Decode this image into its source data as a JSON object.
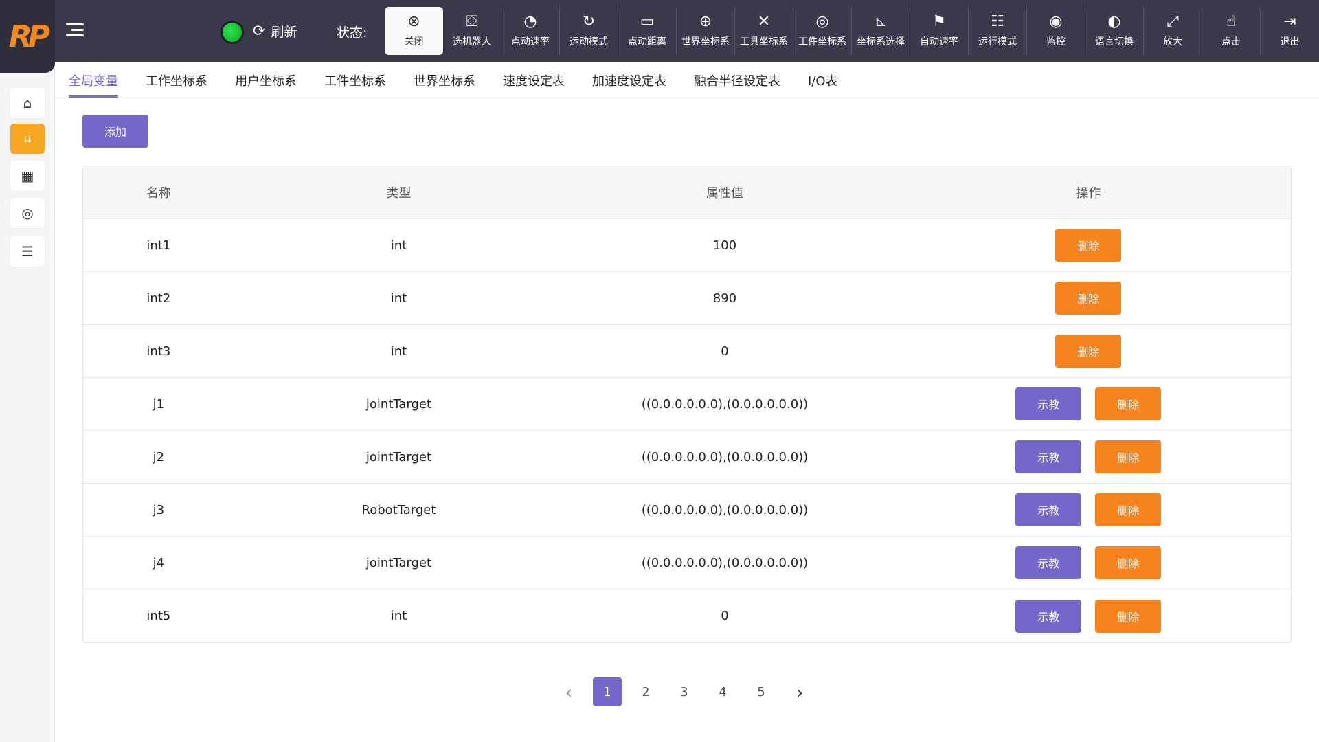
{
  "app": {
    "logo_text": "RP"
  },
  "header": {
    "refresh_label": "刷新",
    "status_label": "状态:",
    "status_color": "#22c43a",
    "toolbar": [
      {
        "label": "关闭",
        "icon": "close-circle-icon",
        "active": true
      },
      {
        "label": "选机器人",
        "icon": "robot-icon"
      },
      {
        "label": "点动速率",
        "icon": "speedometer-icon"
      },
      {
        "label": "运动模式",
        "icon": "cycle-icon"
      },
      {
        "label": "点动距离",
        "icon": "ruler-icon"
      },
      {
        "label": "世界坐标系",
        "icon": "globe-icon"
      },
      {
        "label": "工具坐标系",
        "icon": "tools-icon"
      },
      {
        "label": "工件坐标系",
        "icon": "workpiece-icon"
      },
      {
        "label": "坐标系选择",
        "icon": "axes-icon"
      },
      {
        "label": "自动速率",
        "icon": "runner-icon"
      },
      {
        "label": "运行模式",
        "icon": "list-icon"
      },
      {
        "label": "监控",
        "icon": "camera-icon"
      },
      {
        "label": "语言切换",
        "icon": "language-icon"
      },
      {
        "label": "放大",
        "icon": "expand-icon"
      },
      {
        "label": "点击",
        "icon": "touch-icon"
      },
      {
        "label": "退出",
        "icon": "logout-icon"
      }
    ]
  },
  "sidebar": {
    "items": [
      {
        "name": "home",
        "icon": "home-icon"
      },
      {
        "name": "program",
        "icon": "frame-icon",
        "active": true
      },
      {
        "name": "table",
        "icon": "grid-icon"
      },
      {
        "name": "settings",
        "icon": "target-icon"
      },
      {
        "name": "storage",
        "icon": "database-icon"
      }
    ]
  },
  "tabs": [
    "全局变量",
    "工作坐标系",
    "用户坐标系",
    "工件坐标系",
    "世界坐标系",
    "速度设定表",
    "加速度设定表",
    "融合半径设定表",
    "I/O表"
  ],
  "actions": {
    "add": "添加",
    "teach": "示教",
    "delete": "删除"
  },
  "table": {
    "headers": [
      "名称",
      "类型",
      "属性值",
      "操作"
    ],
    "rows": [
      {
        "name": "int1",
        "type": "int",
        "value": "100",
        "teach": false
      },
      {
        "name": "int2",
        "type": "int",
        "value": "890",
        "teach": false
      },
      {
        "name": "int3",
        "type": "int",
        "value": "0",
        "teach": false
      },
      {
        "name": "j1",
        "type": "jointTarget",
        "value": "((0.0.0.0.0.0),(0.0.0.0.0.0))",
        "teach": true
      },
      {
        "name": "j2",
        "type": "jointTarget",
        "value": "((0.0.0.0.0.0),(0.0.0.0.0.0))",
        "teach": true
      },
      {
        "name": "j3",
        "type": "RobotTarget",
        "value": "((0.0.0.0.0.0),(0.0.0.0.0.0))",
        "teach": true
      },
      {
        "name": "j4",
        "type": "jointTarget",
        "value": "((0.0.0.0.0.0),(0.0.0.0.0.0))",
        "teach": true
      },
      {
        "name": "int5",
        "type": "int",
        "value": "0",
        "teach": true
      }
    ]
  },
  "pagination": {
    "pages": [
      "1",
      "2",
      "3",
      "4",
      "5"
    ],
    "current": "1",
    "prev": "‹",
    "next": "›"
  }
}
